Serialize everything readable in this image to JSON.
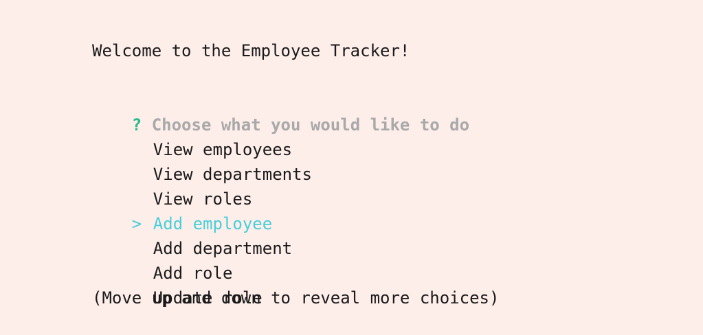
{
  "welcome": "Welcome to the Employee Tracker!",
  "prompt": {
    "marker": "?",
    "question": "Choose what you would like to do"
  },
  "pointer": ">",
  "choices": [
    {
      "label": "View employees",
      "selected": false
    },
    {
      "label": "View departments",
      "selected": false
    },
    {
      "label": "View roles",
      "selected": false
    },
    {
      "label": "Add employee",
      "selected": true
    },
    {
      "label": "Add department",
      "selected": false
    },
    {
      "label": "Add role",
      "selected": false
    },
    {
      "label": "Update role",
      "selected": false
    }
  ],
  "hint": "(Move up and down to reveal more choices)",
  "colors": {
    "background": "#fdeeea",
    "marker": "#2bb98e",
    "question": "#a9a9a9",
    "selected": "#47cfd9",
    "text": "#1a1a1a"
  }
}
